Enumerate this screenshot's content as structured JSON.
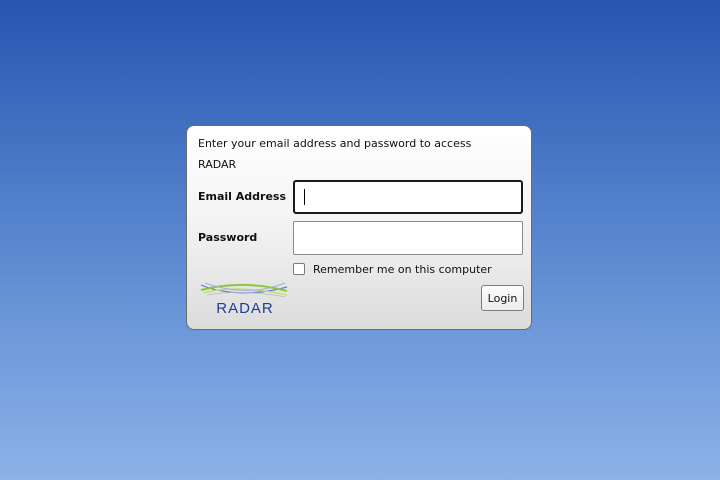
{
  "login": {
    "intro_text": "Enter your email address and password to access RADAR",
    "email_label": "Email Address",
    "email_value": "",
    "password_label": "Password",
    "password_value": "",
    "remember_label": "Remember me on this computer",
    "remember_checked": false,
    "login_button_label": "Login",
    "logo_text": "RADAR"
  },
  "colors": {
    "background_top": "#2855b0",
    "background_bottom": "#8cb2e8",
    "logo_text": "#1f3f94",
    "logo_green": "#8dc63f",
    "logo_blue": "#5a7fc8"
  },
  "icons": {
    "logo": "radar-logo",
    "checkbox": "checkbox-unchecked"
  }
}
